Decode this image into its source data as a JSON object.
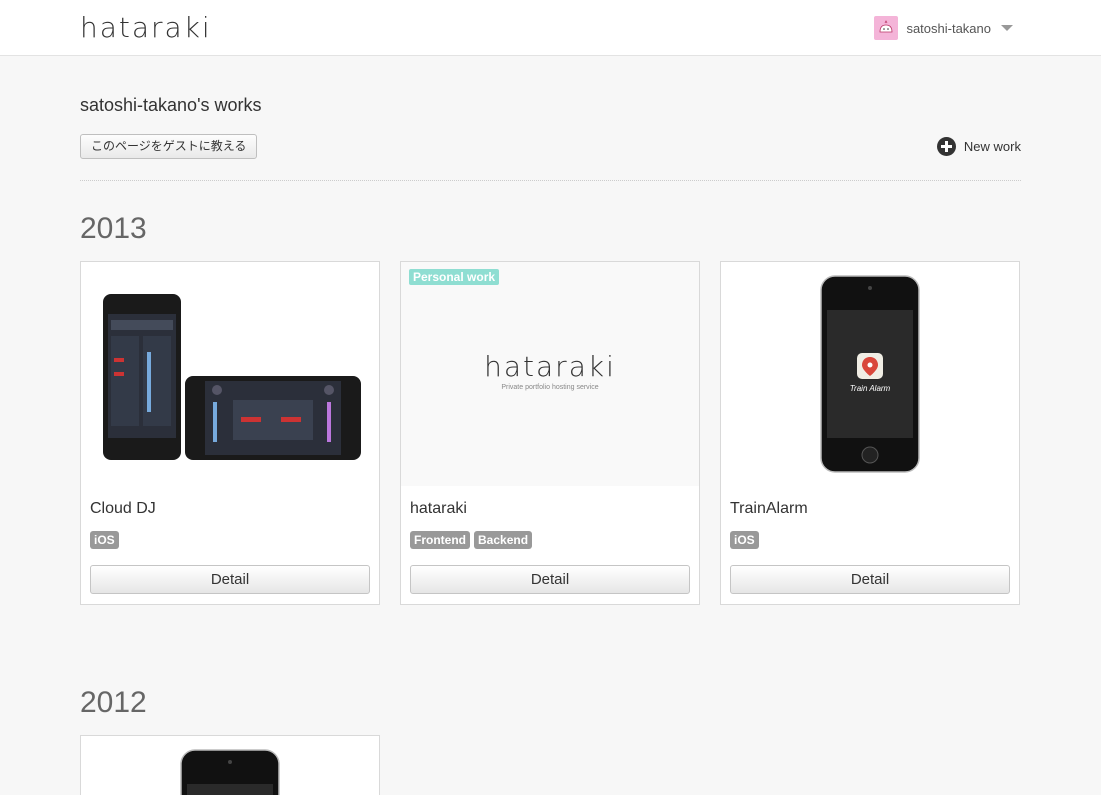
{
  "app": {
    "logo": "hataraki"
  },
  "user": {
    "name": "satoshi-takano"
  },
  "page": {
    "title": "satoshi-takano's works",
    "guest_button": "このページをゲストに教える",
    "new_work": "New work"
  },
  "sections": [
    {
      "year": "2013",
      "works": [
        {
          "title": "Cloud DJ",
          "tags": [
            "iOS"
          ],
          "detail": "Detail"
        },
        {
          "title": "hataraki",
          "badge": "Personal work",
          "thumb_logo": "hataraki",
          "thumb_sub": "Private portfolio hosting service",
          "tags": [
            "Frontend",
            "Backend"
          ],
          "detail": "Detail"
        },
        {
          "title": "TrainAlarm",
          "thumb_app": "Train Alarm",
          "tags": [
            "iOS"
          ],
          "detail": "Detail"
        }
      ]
    },
    {
      "year": "2012"
    }
  ],
  "colors": {
    "personal_badge": "#8fded2",
    "tag": "#999999",
    "avatar": "#f4b4d8"
  },
  "icons": [
    "user-avatar-icon",
    "caret-down-icon",
    "plus-circle-icon",
    "map-pin-icon"
  ]
}
